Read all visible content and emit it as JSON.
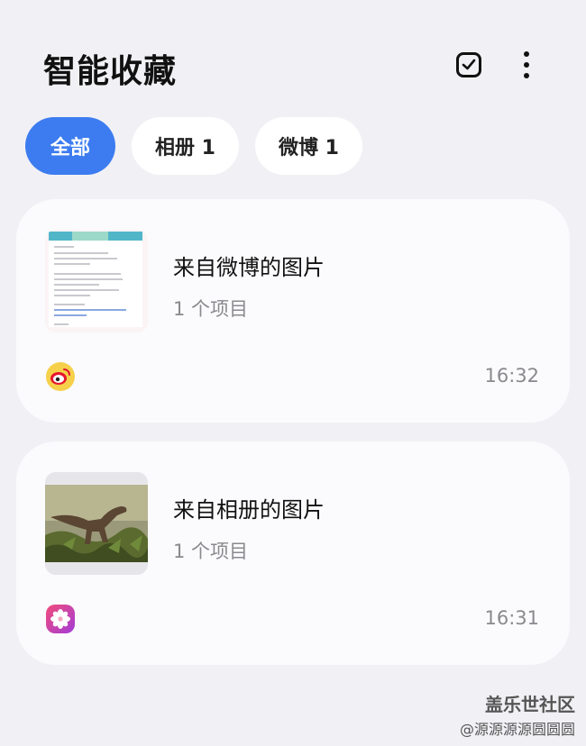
{
  "header": {
    "title": "智能收藏",
    "select_icon": "checkbox-select-icon",
    "more_icon": "more-vertical-icon"
  },
  "filters": [
    {
      "label": "全部",
      "active": true
    },
    {
      "label": "相册 1",
      "active": false
    },
    {
      "label": "微博 1",
      "active": false
    }
  ],
  "cards": [
    {
      "title": "来自微博的图片",
      "count": "1 个项目",
      "time": "16:32",
      "app_icon": "weibo-icon"
    },
    {
      "title": "来自相册的图片",
      "count": "1 个项目",
      "time": "16:31",
      "app_icon": "gallery-icon"
    }
  ],
  "watermark": {
    "line1": "盖乐世社区",
    "line2": "@源源源源圆圆圆"
  },
  "colors": {
    "accent": "#3d7cf0",
    "background": "#f1f1f5",
    "card": "#fbfbfd"
  }
}
